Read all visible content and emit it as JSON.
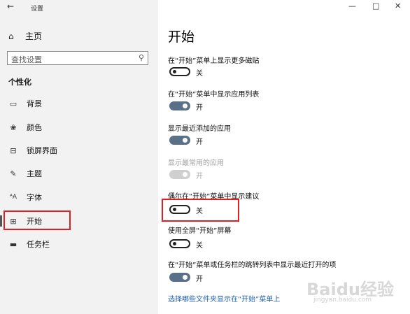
{
  "window": {
    "title": "设置",
    "back_glyph": "←",
    "minimize_glyph": "—",
    "maximize_glyph": "□",
    "close_glyph": "✕"
  },
  "sidebar": {
    "home_icon": "⌂",
    "home_label": "主页",
    "search_placeholder": "查找设置",
    "search_icon": "⚲",
    "section_title": "个性化",
    "items": [
      {
        "label": "背景",
        "icon": "▭",
        "icon_name": "picture-icon"
      },
      {
        "label": "颜色",
        "icon": "❀",
        "icon_name": "palette-icon"
      },
      {
        "label": "锁屏界面",
        "icon": "⊟",
        "icon_name": "lockscreen-icon"
      },
      {
        "label": "主题",
        "icon": "✎",
        "icon_name": "theme-icon"
      },
      {
        "label": "字体",
        "icon": "ᴬA",
        "icon_name": "font-icon"
      },
      {
        "label": "开始",
        "icon": "⊞",
        "icon_name": "start-icon",
        "selected": true
      },
      {
        "label": "任务栏",
        "icon": "▬",
        "icon_name": "taskbar-icon"
      }
    ]
  },
  "main": {
    "title": "开始",
    "options": [
      {
        "label": "在“开始”菜单上显示更多磁贴",
        "state": "off",
        "state_label": "关"
      },
      {
        "label": "在“开始”菜单中显示应用列表",
        "state": "on",
        "state_label": "开"
      },
      {
        "label": "显示最近添加的应用",
        "state": "on",
        "state_label": "开"
      },
      {
        "label": "显示最常用的应用",
        "state": "disabled",
        "state_label": "开"
      },
      {
        "label": "偶尔在“开始”菜单中显示建议",
        "state": "off",
        "state_label": "关"
      },
      {
        "label": "使用全屏“开始”屏幕",
        "state": "off",
        "state_label": "关"
      },
      {
        "label": "在“开始”菜单或任务栏的跳转列表中显示最近打开的项",
        "state": "on",
        "state_label": "开"
      }
    ],
    "link": "选择哪些文件夹显示在“开始”菜单上"
  },
  "colors": {
    "toggle_on": "#5a6f88",
    "highlight_box": "#e02020",
    "link": "#1f5fa8"
  },
  "watermark": {
    "text": "Baidu经验",
    "sub": "jingyan.baidu.com"
  }
}
